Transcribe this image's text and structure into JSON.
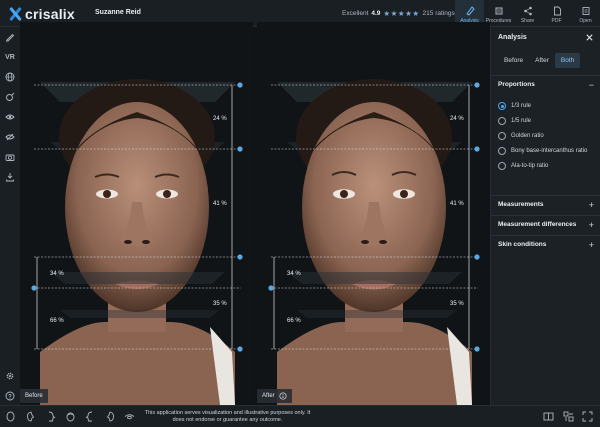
{
  "app": {
    "brand": "crisalix",
    "patient_name": "Suzanne Reid"
  },
  "rating": {
    "label": "Excellent",
    "score": "4.9",
    "stars": "★★★★★",
    "count": "215 ratings"
  },
  "topnav": [
    {
      "label": "Analysis",
      "icon": "analysis-icon",
      "active": true
    },
    {
      "label": "Procedures",
      "icon": "procedures-icon",
      "active": false
    },
    {
      "label": "Share",
      "icon": "share-icon",
      "active": false
    },
    {
      "label": "PDF",
      "icon": "pdf-icon",
      "active": false
    },
    {
      "label": "Open",
      "icon": "open-icon",
      "active": false
    }
  ],
  "toolbar": {
    "vr_label": "VR"
  },
  "panes": {
    "before": {
      "label": "Before"
    },
    "after": {
      "label": "After"
    }
  },
  "proportions_overlay": {
    "upper_pct": "24 %",
    "mid_pct": "41 %",
    "lower_upper_pct": "34 %",
    "lower_lower_pct": "66 %",
    "lower_right_pct": "35 %"
  },
  "panel": {
    "title": "Analysis",
    "view_modes": [
      "Before",
      "After",
      "Both"
    ],
    "active_view_mode": "Both",
    "sections": {
      "proportions": "Proportions",
      "measurements": "Measurements",
      "measurement_differences": "Measurement differences",
      "skin_conditions": "Skin conditions"
    },
    "rules": [
      {
        "label": "1/3 rule",
        "selected": true
      },
      {
        "label": "1/5 rule",
        "selected": false
      },
      {
        "label": "Golden ratio",
        "selected": false
      },
      {
        "label": "Bony base-intercanthus ratio",
        "selected": false
      },
      {
        "label": "Ala-to-tip ratio",
        "selected": false
      }
    ]
  },
  "footer": {
    "disclaimer": "This application serves visualization and illustrative purposes only. It does not endorse or guarantee any outcome."
  },
  "colors": {
    "accent": "#4aa8ee",
    "background": "#14181c",
    "panel": "#1c2126"
  }
}
